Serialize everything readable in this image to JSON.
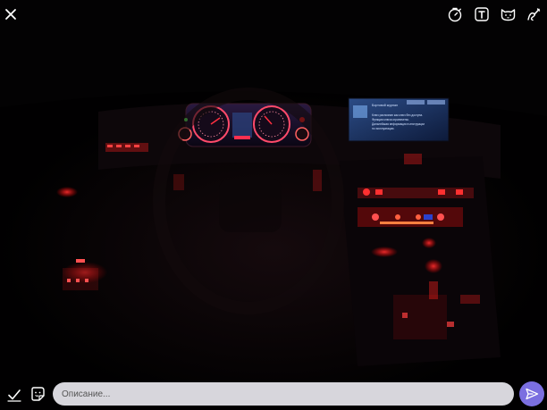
{
  "editor": {
    "caption_placeholder": "Описание..."
  },
  "icons": {
    "close": "close-icon",
    "timer": "timer-icon",
    "text": "text-icon",
    "sticker": "cat-sticker-icon",
    "draw": "doodle-icon",
    "confirm": "checkmark-icon",
    "sticker_panel": "sticker-icon",
    "send": "send-icon"
  },
  "colors": {
    "send_accent": "#7b6fe0",
    "caption_bg": "#d7d6dc",
    "icons": "#ffffff"
  },
  "photo": {
    "screen_title": "Бортовой журнал",
    "screen_message": "Ключ распознан как ключ без доступа. Функции ключа ограничены. Дальнейшая информация в инструкции по эксплуатации."
  }
}
